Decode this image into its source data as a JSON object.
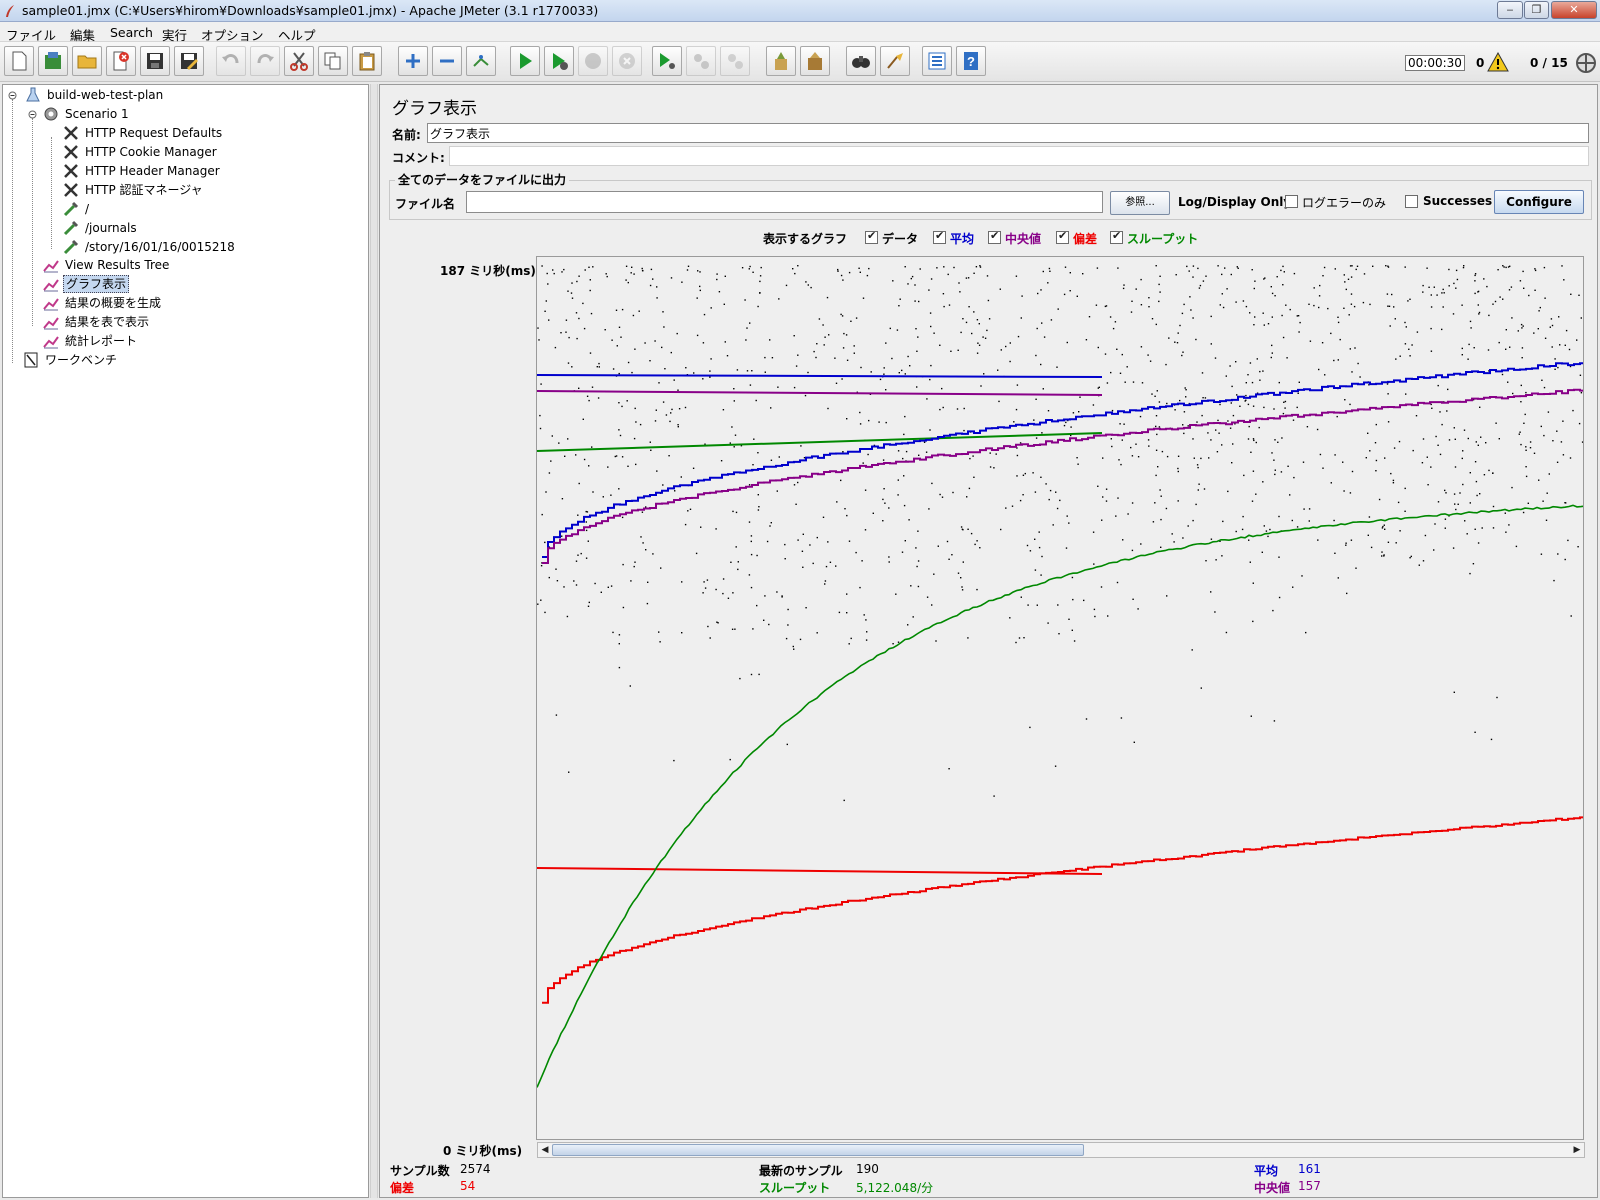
{
  "window": {
    "title": "sample01.jmx (C:¥Users¥hirom¥Downloads¥sample01.jmx) - Apache JMeter (3.1 r1770033)",
    "minimize": "‒",
    "maximize": "❐",
    "close": "✕"
  },
  "menu": [
    "ファイル",
    "編集",
    "Search",
    "実行",
    "オプション",
    "ヘルプ"
  ],
  "toolbar": {
    "timer": "00:00:30",
    "error_count": "0",
    "thread_count": "0 / 15"
  },
  "tree": {
    "items": [
      {
        "label": "build-web-test-plan"
      },
      {
        "label": "Scenario 1"
      },
      {
        "label": "HTTP Request Defaults"
      },
      {
        "label": "HTTP Cookie Manager"
      },
      {
        "label": "HTTP Header Manager"
      },
      {
        "label": "HTTP 認証マネージャ"
      },
      {
        "label": "/"
      },
      {
        "label": "/journals"
      },
      {
        "label": "/story/16/01/16/0015218"
      },
      {
        "label": "View Results Tree"
      },
      {
        "label": "グラフ表示"
      },
      {
        "label": "結果の概要を生成"
      },
      {
        "label": "結果を表で表示"
      },
      {
        "label": "統計レポート"
      },
      {
        "label": "ワークベンチ"
      }
    ]
  },
  "panel": {
    "title": "グラフ表示",
    "name_label": "名前:",
    "name_value": "グラフ表示",
    "comment_label": "コメント:",
    "comment_value": "",
    "file_section": "全てのデータをファイルに出力",
    "file_label": "ファイル名",
    "file_value": "",
    "browse": "参照...",
    "log_display_only": "Log/Display Only:",
    "errors_only": "ログエラーのみ",
    "successes": "Successes",
    "configure": "Configure"
  },
  "graph_options": {
    "label": "表示するグラフ",
    "items": [
      {
        "label": "データ",
        "color": "#000000",
        "checked": true
      },
      {
        "label": "平均",
        "color": "#0000cc",
        "checked": true
      },
      {
        "label": "中央値",
        "color": "#880088",
        "checked": true
      },
      {
        "label": "偏差",
        "color": "#ee0000",
        "checked": true
      },
      {
        "label": "スループット",
        "color": "#008800",
        "checked": true
      }
    ]
  },
  "axis": {
    "y_max": "187 ミリ秒(ms)",
    "y_min": "0 ミリ秒(ms)"
  },
  "stats": {
    "samples_label": "サンプル数",
    "samples_value": "2574",
    "deviation_label": "偏差",
    "deviation_value": "54",
    "latest_label": "最新のサンプル",
    "latest_value": "190",
    "throughput_label": "スループット",
    "throughput_value": "5,122.048/分",
    "average_label": "平均",
    "average_value": "161",
    "median_label": "中央値",
    "median_value": "157"
  },
  "colors": {
    "data": "#000000",
    "average": "#0000cc",
    "median": "#880088",
    "deviation": "#ee0000",
    "throughput": "#008800"
  }
}
